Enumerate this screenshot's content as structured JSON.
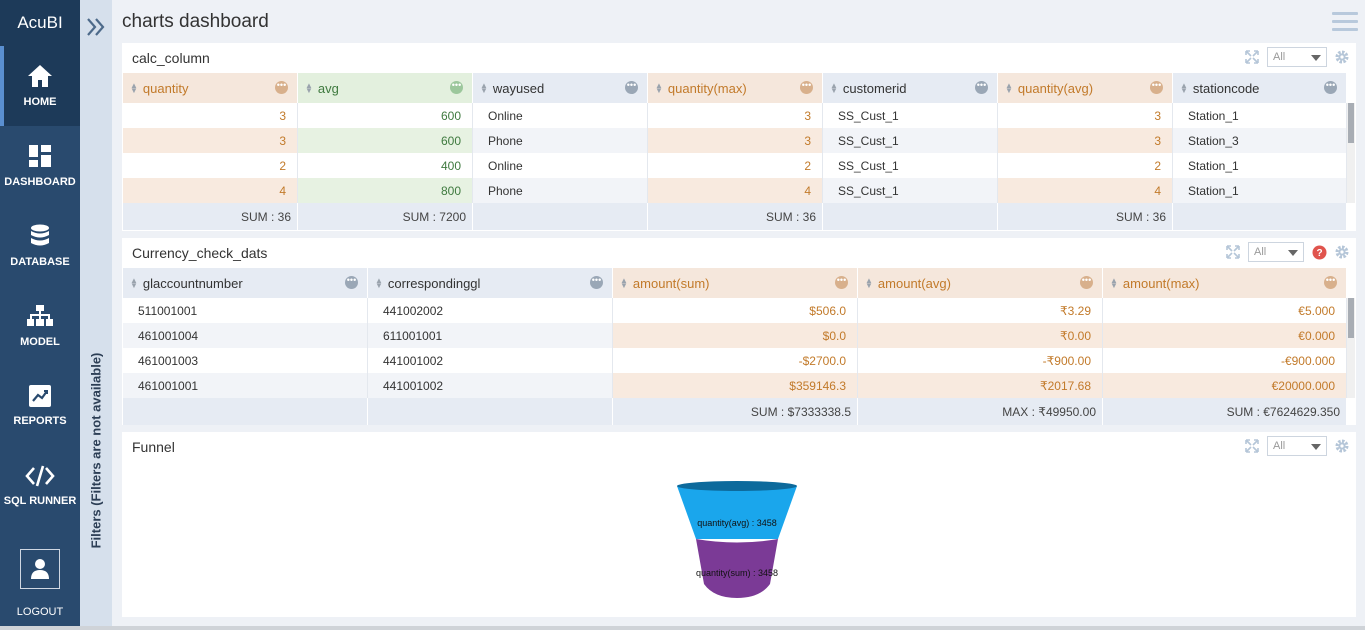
{
  "app": {
    "logo": "AcuBI",
    "title": "charts dashboard"
  },
  "sidebar": {
    "items": [
      {
        "label": "HOME",
        "icon": "home-icon",
        "active": true
      },
      {
        "label": "DASHBOARD",
        "icon": "dashboard-icon"
      },
      {
        "label": "DATABASE",
        "icon": "database-icon"
      },
      {
        "label": "MODEL",
        "icon": "model-icon"
      },
      {
        "label": "REPORTS",
        "icon": "reports-icon"
      },
      {
        "label": "SQL RUNNER",
        "icon": "code-icon"
      }
    ],
    "logout": "LOGOUT"
  },
  "filters": {
    "label": "Filters (Filters are not available)"
  },
  "panels": {
    "calc": {
      "title": "calc_column",
      "select": "All",
      "columns": [
        "quantity",
        "avg",
        "wayused",
        "quantity(max)",
        "customerid",
        "quantity(avg)",
        "stationcode"
      ],
      "rows": [
        [
          "3",
          "600",
          "Online",
          "3",
          "SS_Cust_1",
          "3",
          "Station_1"
        ],
        [
          "3",
          "600",
          "Phone",
          "3",
          "SS_Cust_1",
          "3",
          "Station_3"
        ],
        [
          "2",
          "400",
          "Online",
          "2",
          "SS_Cust_1",
          "2",
          "Station_1"
        ],
        [
          "4",
          "800",
          "Phone",
          "4",
          "SS_Cust_1",
          "4",
          "Station_1"
        ]
      ],
      "footer": [
        "SUM : 36",
        "SUM : 7200",
        "",
        "SUM : 36",
        "",
        "SUM : 36",
        ""
      ]
    },
    "currency": {
      "title": "Currency_check_dats",
      "select": "All",
      "columns": [
        "glaccountnumber",
        "correspondinggl",
        "amount(sum)",
        "amount(avg)",
        "amount(max)"
      ],
      "rows": [
        [
          "511001001",
          "441002002",
          "$506.0",
          "₹3.29",
          "€5.000"
        ],
        [
          "461001004",
          "611001001",
          "$0.0",
          "₹0.00",
          "€0.000"
        ],
        [
          "461001003",
          "441001002",
          "-$2700.0",
          "-₹900.00",
          "-€900.000"
        ],
        [
          "461001001",
          "441001002",
          "$359146.3",
          "₹2017.68",
          "€20000.000"
        ]
      ],
      "footer": [
        "",
        "",
        "SUM : $7333338.5",
        "MAX : ₹49950.00",
        "SUM : €7624629.350"
      ]
    },
    "funnel": {
      "title": "Funnel",
      "select": "All",
      "chart_data": {
        "type": "funnel",
        "series": [
          {
            "name": "quantity(avg)",
            "value": 3458,
            "label": "quantity(avg) : 3458",
            "color": "#1aa6ec"
          },
          {
            "name": "quantity(sum)",
            "value": 3458,
            "label": "quantity(sum) : 3458",
            "color": "#7b3a96"
          }
        ]
      }
    }
  },
  "colors": {
    "sidebar": "#294a6e",
    "orange_header": "#f5e7dc",
    "green_header": "#e3f0de",
    "blue_header": "#e6ebf3",
    "orange_text": "#c27a2a",
    "green_text": "#3f7a3f"
  }
}
